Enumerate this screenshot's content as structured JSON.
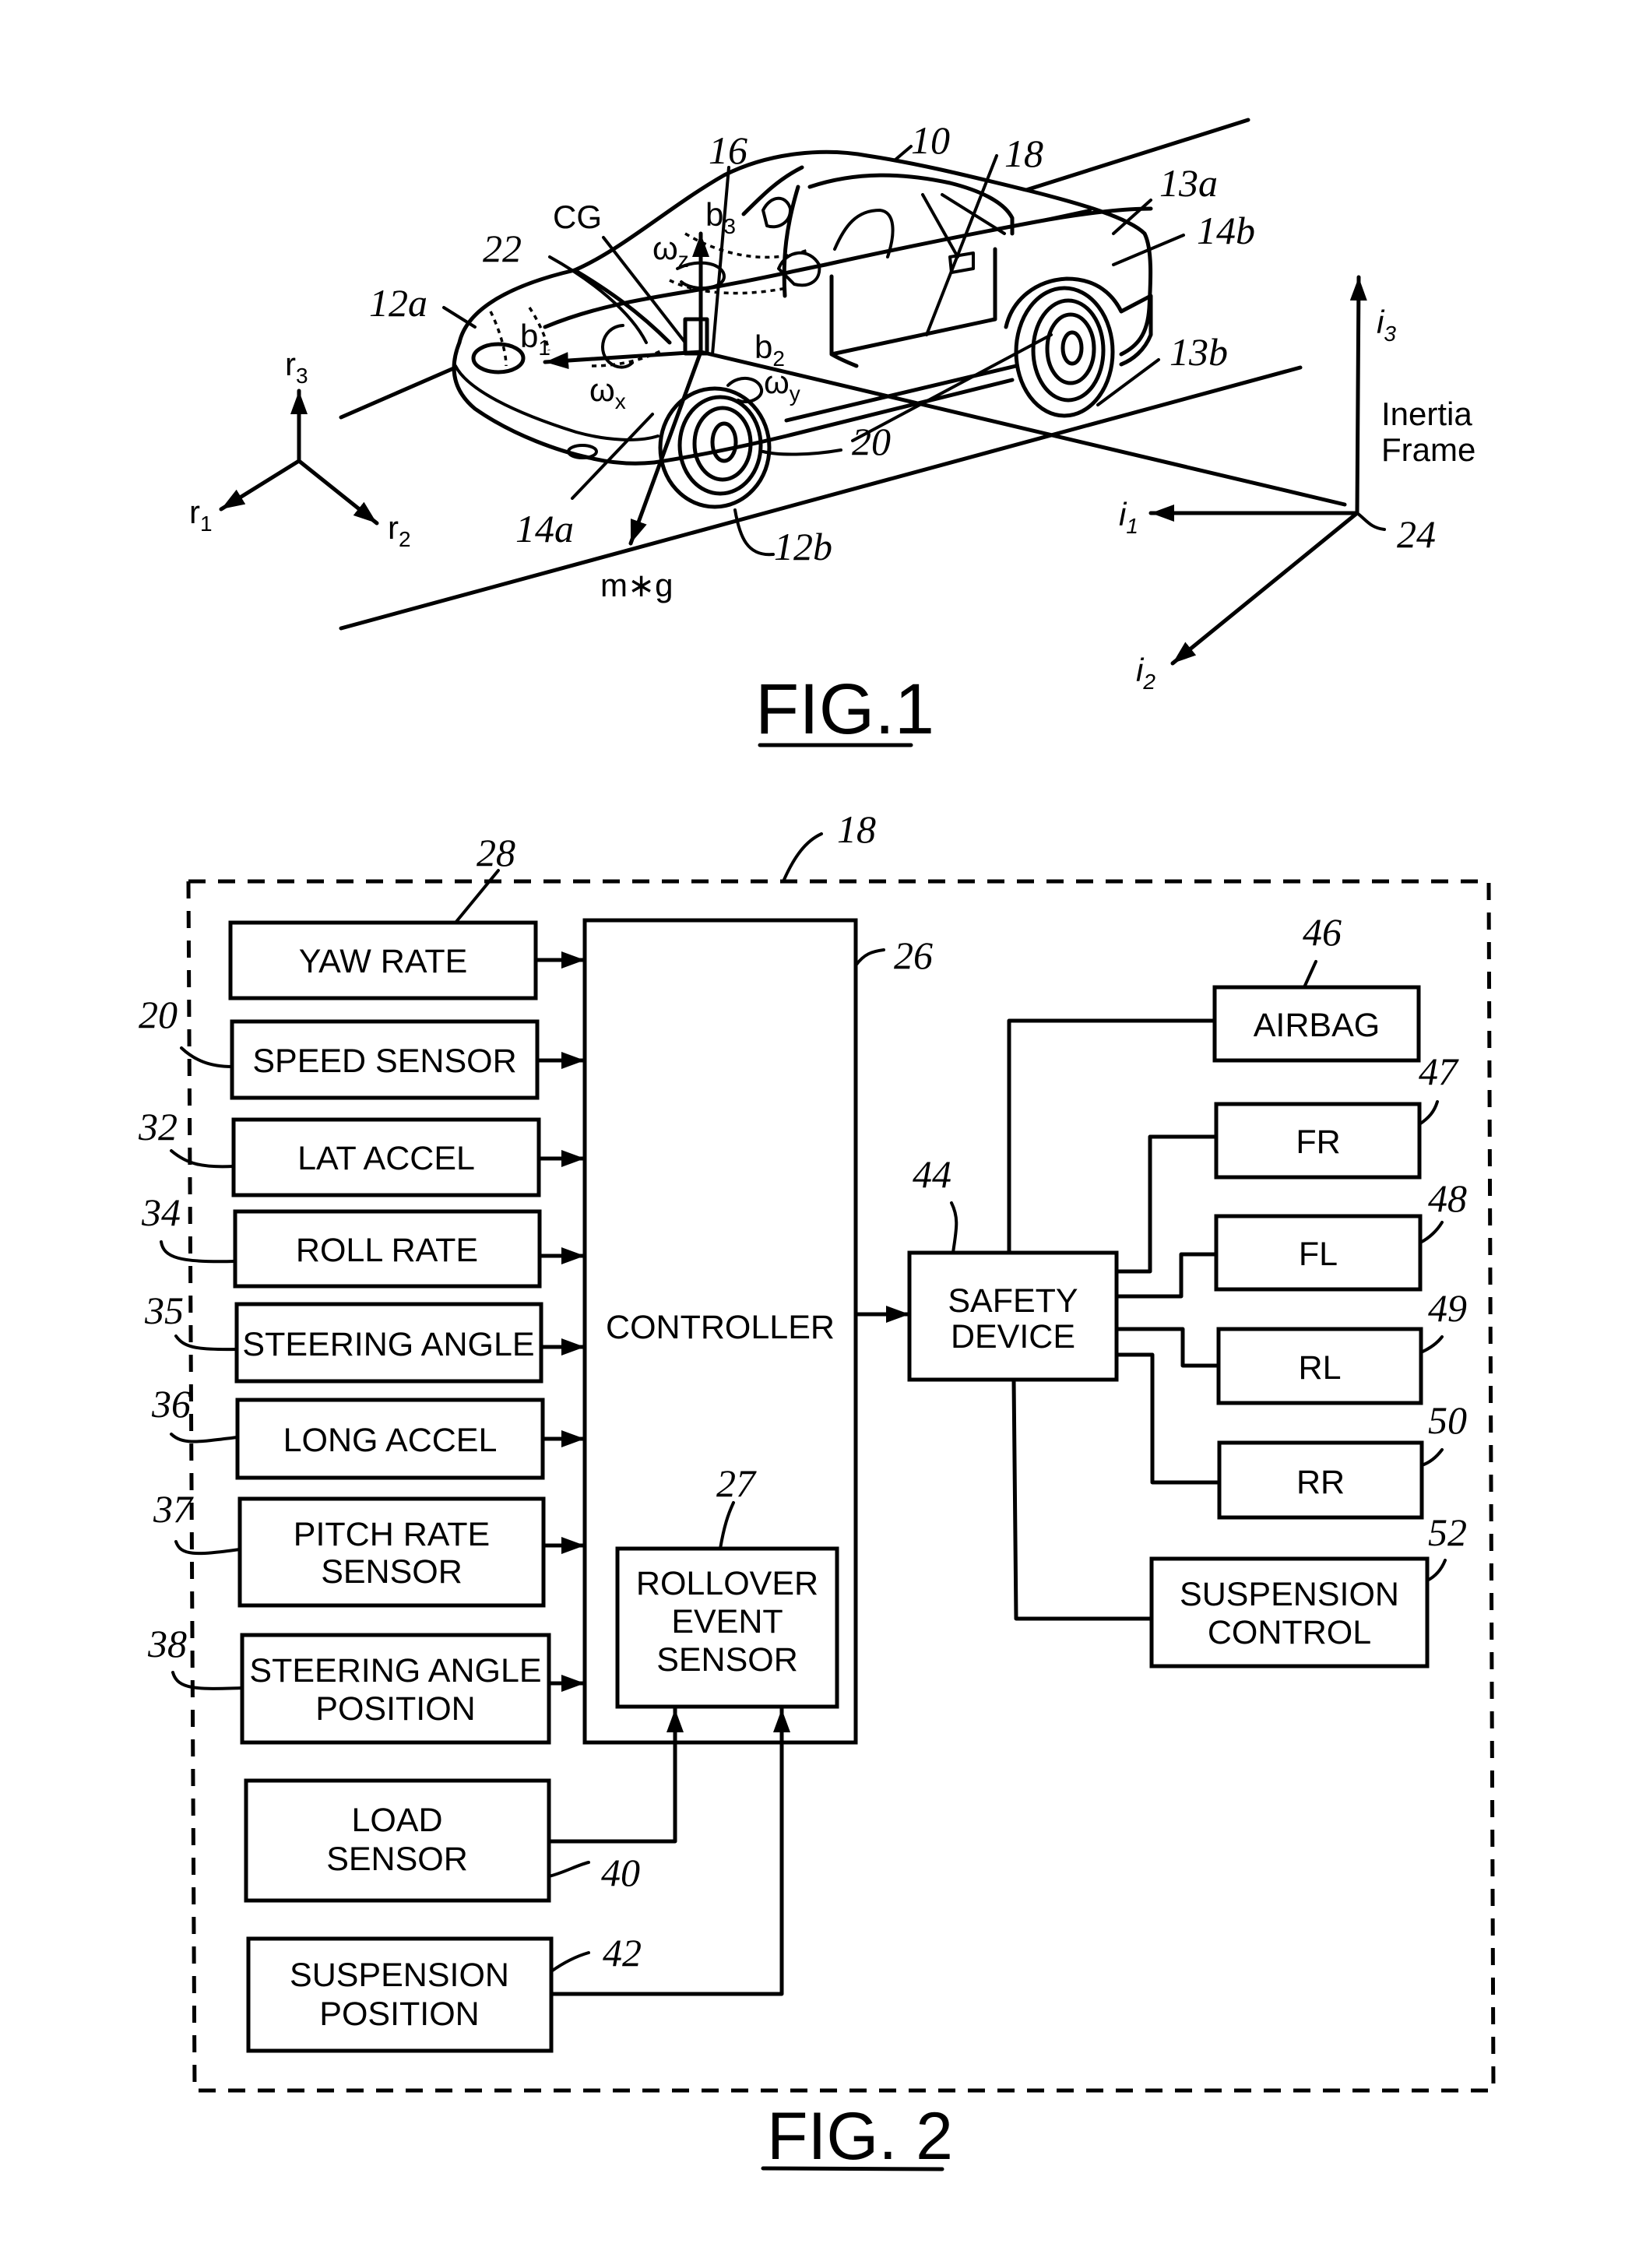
{
  "fig1": {
    "caption": "FIG.1",
    "car_ref": "10",
    "labels": {
      "l16": "16",
      "l18": "18",
      "l22": "22",
      "cg": "CG",
      "l12a": "12a",
      "l12b": "12b",
      "l13a": "13a",
      "l13b": "13b",
      "l14a": "14a",
      "l14b": "14b",
      "l20": "20",
      "l24": "24",
      "mg": "m∗g",
      "inertia_line1": "Inertia",
      "inertia_line2": "Frame"
    },
    "body_axes": {
      "b1": {
        "base": "b",
        "sub": "1"
      },
      "b2": {
        "base": "b",
        "sub": "2"
      },
      "b3": {
        "base": "b",
        "sub": "3"
      },
      "wx": {
        "base": "ω",
        "sub": "x"
      },
      "wy": {
        "base": "ω",
        "sub": "y"
      },
      "wz": {
        "base": "ω",
        "sub": "z"
      }
    },
    "road_axes": {
      "r1": {
        "base": "r",
        "sub": "1"
      },
      "r2": {
        "base": "r",
        "sub": "2"
      },
      "r3": {
        "base": "r",
        "sub": "3"
      }
    },
    "inertia_axes": {
      "i1": {
        "base": "i",
        "sub": "1"
      },
      "i2": {
        "base": "i",
        "sub": "2"
      },
      "i3": {
        "base": "i",
        "sub": "3"
      }
    }
  },
  "fig2": {
    "caption": "FIG. 2",
    "system_ref": "18",
    "sensors": [
      {
        "label": "YAW RATE",
        "ref": "28"
      },
      {
        "label": "SPEED SENSOR",
        "ref": "20"
      },
      {
        "label": "LAT ACCEL",
        "ref": "32"
      },
      {
        "label": "ROLL RATE",
        "ref": "34"
      },
      {
        "label": "STEERING ANGLE",
        "ref": "35"
      },
      {
        "label": "LONG ACCEL",
        "ref": "36"
      },
      {
        "label_line1": "PITCH RATE",
        "label_line2": "SENSOR",
        "ref": "37"
      },
      {
        "label_line1": "STEERING ANGLE",
        "label_line2": "POSITION",
        "ref": "38"
      }
    ],
    "controller": {
      "label": "CONTROLLER",
      "ref": "26"
    },
    "rollover": {
      "line1": "ROLLOVER",
      "line2": "EVENT",
      "line3": "SENSOR",
      "ref": "27"
    },
    "load_sensor": {
      "line1": "LOAD",
      "line2": "SENSOR",
      "ref": "40"
    },
    "suspension_position": {
      "line1": "SUSPENSION",
      "line2": "POSITION",
      "ref": "42"
    },
    "safety_device": {
      "line1": "SAFETY",
      "line2": "DEVICE",
      "ref": "44"
    },
    "outputs": [
      {
        "label": "AIRBAG",
        "ref": "46"
      },
      {
        "label": "FR",
        "ref": "47"
      },
      {
        "label": "FL",
        "ref": "48"
      },
      {
        "label": "RL",
        "ref": "49"
      },
      {
        "label": "RR",
        "ref": "50"
      },
      {
        "line1": "SUSPENSION",
        "line2": "CONTROL",
        "ref": "52"
      }
    ]
  }
}
